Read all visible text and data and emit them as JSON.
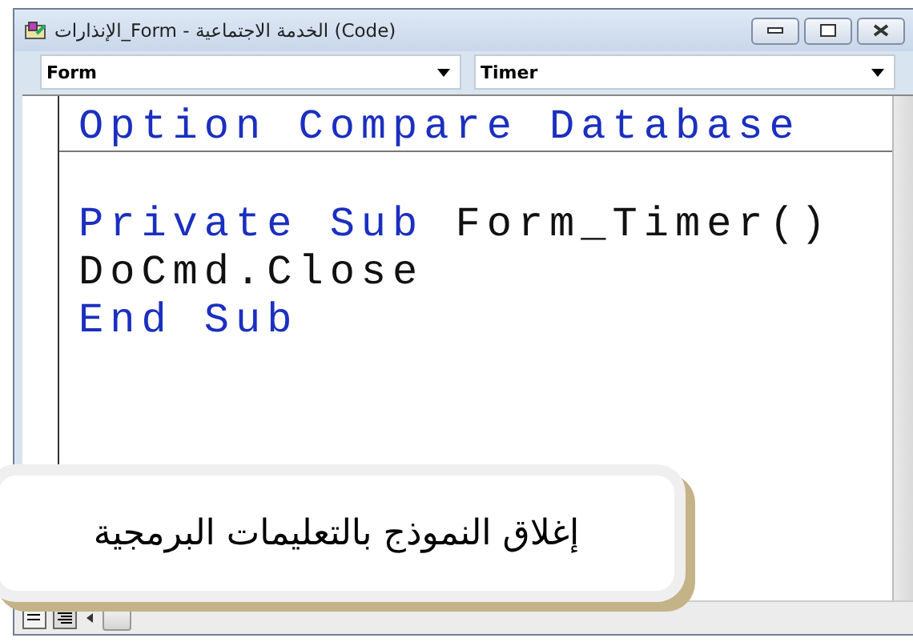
{
  "window": {
    "title": "الإنذارات_Form - الخدمة الاجتماعية (Code)"
  },
  "dropdowns": [
    {
      "value": "Form"
    },
    {
      "value": "Timer"
    }
  ],
  "code_sections": [
    {
      "lines": [
        [
          {
            "text": "Option Compare Database",
            "kind": "keyword"
          }
        ]
      ]
    },
    {
      "lines": [
        [
          {
            "text": "Private Sub",
            "kind": "keyword"
          },
          {
            "text": " Form_Timer()",
            "kind": "plain"
          }
        ],
        [
          {
            "text": "DoCmd.Close",
            "kind": "plain"
          }
        ],
        [
          {
            "text": "End Sub",
            "kind": "keyword"
          }
        ]
      ]
    }
  ],
  "caption": {
    "text": "إغلاق النموذج بالتعليمات البرمجية"
  }
}
